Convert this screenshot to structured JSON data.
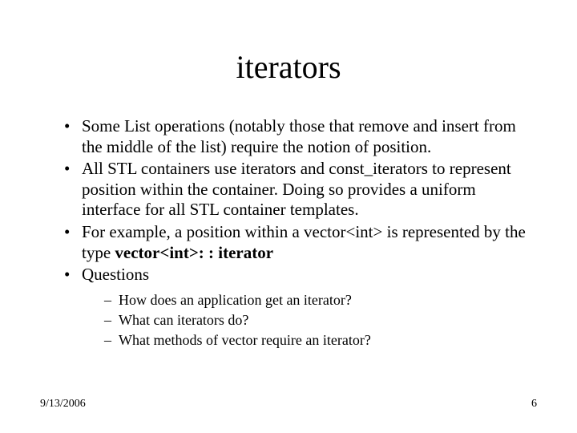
{
  "title": "iterators",
  "bullets": [
    {
      "text": "Some List operations (notably those that remove and insert from the middle of the list) require the notion of position."
    },
    {
      "text": "All STL containers use iterators and const_iterators to represent position within the container.  Doing so provides a uniform interface for all STL container templates."
    },
    {
      "pre": "For example, a position within a vector<int> is represented by the type ",
      "bold": "vector<int>: : iterator"
    },
    {
      "text": "Questions",
      "sub": [
        "How does an application get an iterator?",
        "What can iterators do?",
        "What methods of vector require an iterator?"
      ]
    }
  ],
  "footer": {
    "date": "9/13/2006",
    "page": "6"
  }
}
